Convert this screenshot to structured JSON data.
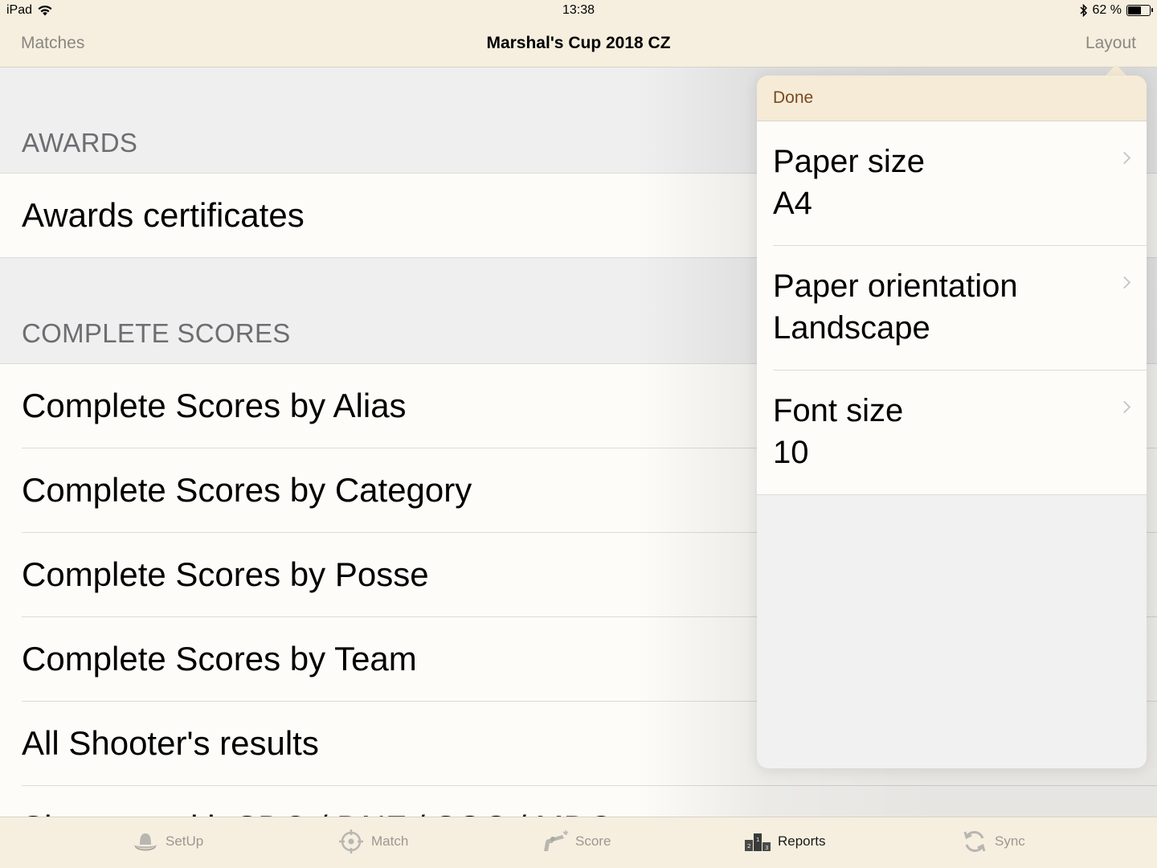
{
  "status_bar": {
    "device": "iPad",
    "time": "13:38",
    "battery_text": "62 %",
    "battery_level": 0.62
  },
  "nav_bar": {
    "back_label": "Matches",
    "title": "Marshal's Cup 2018 CZ",
    "right_label": "Layout"
  },
  "sections": [
    {
      "header": "AWARDS",
      "items": [
        "Awards certificates"
      ]
    },
    {
      "header": "COMPLETE SCORES",
      "items": [
        "Complete Scores by Alias",
        "Complete Scores by Category",
        "Complete Scores by Posse",
        "Complete Scores by Team",
        "All Shooter's results",
        "Shooters with SDQ / DNF / SOC / MDQ"
      ]
    }
  ],
  "popover": {
    "done_label": "Done",
    "rows": [
      {
        "title": "Paper size",
        "value": "A4"
      },
      {
        "title": "Paper orientation",
        "value": "Landscape"
      },
      {
        "title": "Font size",
        "value": "10"
      }
    ]
  },
  "tab_bar": {
    "tabs": [
      {
        "label": "SetUp",
        "icon": "cowboy-hat-icon"
      },
      {
        "label": "Match",
        "icon": "crosshair-icon"
      },
      {
        "label": "Score",
        "icon": "revolver-icon"
      },
      {
        "label": "Reports",
        "icon": "podium-icon"
      },
      {
        "label": "Sync",
        "icon": "sync-icon"
      }
    ],
    "active": "Reports"
  },
  "colors": {
    "bar_background": "#f6efdf",
    "popover_header": "#f5ebd6",
    "done_color": "#7a4a1f",
    "row_background": "#fdfcf8",
    "section_background": "#efefef"
  }
}
